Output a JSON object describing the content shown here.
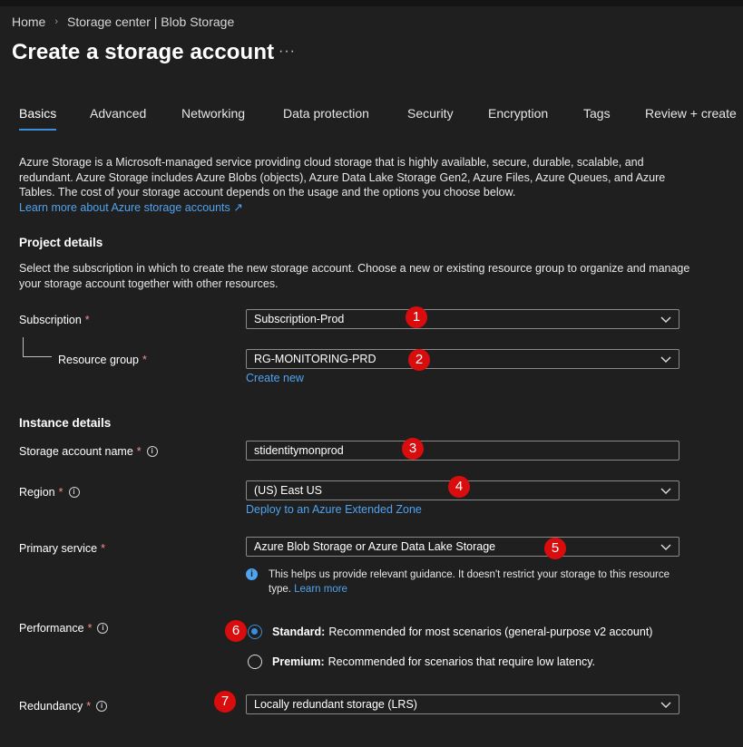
{
  "breadcrumb": {
    "home": "Home",
    "current": "Storage center | Blob Storage"
  },
  "page": {
    "title": "Create a storage account",
    "more": "···"
  },
  "tabs": [
    "Basics",
    "Advanced",
    "Networking",
    "Data protection",
    "Security",
    "Encryption",
    "Tags",
    "Review + create"
  ],
  "intro": {
    "text": "Azure Storage is a Microsoft-managed service providing cloud storage that is highly available, secure, durable, scalable, and redundant. Azure Storage includes Azure Blobs (objects), Azure Data Lake Storage Gen2, Azure Files, Azure Queues, and Azure Tables. The cost of your storage account depends on the usage and the options you choose below.",
    "link": "Learn more about Azure storage accounts"
  },
  "project": {
    "title": "Project details",
    "desc": "Select the subscription in which to create the new storage account. Choose a new or existing resource group to organize and manage your storage account together with other resources.",
    "subscription_label": "Subscription",
    "subscription_value": "Subscription-Prod",
    "rg_label": "Resource group",
    "rg_value": "RG-MONITORING-PRD",
    "create_new": "Create new"
  },
  "instance": {
    "title": "Instance details",
    "name_label": "Storage account name",
    "name_value": "stidentitymonprod",
    "region_label": "Region",
    "region_value": "(US) East US",
    "region_link": "Deploy to an Azure Extended Zone",
    "service_label": "Primary service",
    "service_value": "Azure Blob Storage or Azure Data Lake Storage",
    "service_note": "This helps us provide relevant guidance. It doesn't restrict your storage to this resource type.",
    "service_note_link": "Learn more",
    "perf_label": "Performance",
    "perf_standard_title": "Standard:",
    "perf_standard_desc": "Recommended for most scenarios (general-purpose v2 account)",
    "perf_premium_title": "Premium:",
    "perf_premium_desc": "Recommended for scenarios that require low latency.",
    "perf_selected": "Standard",
    "redundancy_label": "Redundancy",
    "redundancy_value": "Locally redundant storage (LRS)"
  },
  "required_mark": "*",
  "badges": [
    "1",
    "2",
    "3",
    "4",
    "5",
    "6",
    "7"
  ],
  "colors": {
    "background": "#1f1f1f",
    "accent": "#3c8eda",
    "link": "#4fa3ef",
    "badge": "#d90d0d",
    "required": "#f28d8d"
  }
}
